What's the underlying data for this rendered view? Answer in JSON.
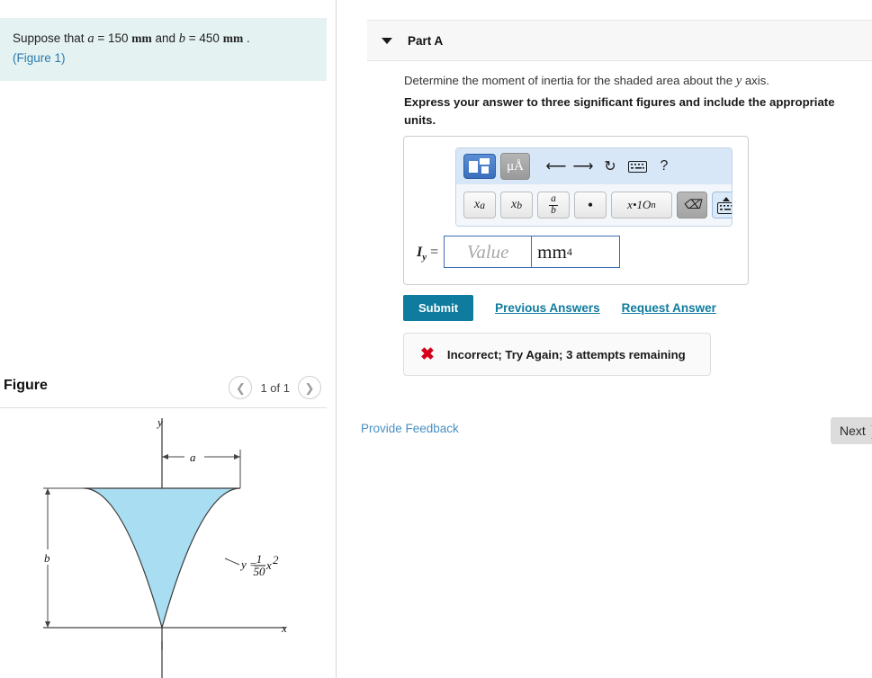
{
  "question": {
    "prefix": "Suppose that ",
    "var_a": "a",
    "eq1": " = 150 ",
    "unit1": "mm",
    "mid": " and ",
    "var_b": "b",
    "eq2": " = 450 ",
    "unit2": "mm",
    "suffix": " .",
    "figure_link": "(Figure 1)"
  },
  "figure_panel": {
    "title": "Figure",
    "counter": "1 of 1",
    "prev_icon": "chevron-left-icon",
    "next_icon": "chevron-right-icon"
  },
  "figure": {
    "y_axis_label": "y",
    "x_axis_label": "x",
    "dim_a_label": "a",
    "dim_b_label": "b",
    "curve_eq_lhs": "y =",
    "curve_eq_num": "1",
    "curve_eq_den": "50",
    "curve_eq_var": "x",
    "curve_eq_exp": "2",
    "fill_color": "#a9ddf2",
    "stroke_color": "#3a3a3a"
  },
  "part": {
    "caret_icon": "caret-down-icon",
    "title": "Part A",
    "prompt_pre": "Determine the moment of inertia for the shaded area about the ",
    "prompt_var": "y",
    "prompt_post": " axis.",
    "instruction": "Express your answer to three significant figures and include the appropriate units."
  },
  "toolbar": {
    "row1": [
      {
        "name": "template-picker-icon",
        "label": ""
      },
      {
        "name": "units-micro-angstrom-icon",
        "label": "μÅ"
      },
      {
        "name": "undo-icon",
        "label": "↶"
      },
      {
        "name": "redo-icon",
        "label": "↷"
      },
      {
        "name": "reset-icon",
        "label": "↻"
      },
      {
        "name": "keyboard-icon",
        "label": ""
      },
      {
        "name": "help-icon",
        "label": "?"
      }
    ],
    "row2": [
      {
        "name": "superscript-key",
        "label": "x",
        "sup": "a"
      },
      {
        "name": "subscript-key",
        "label": "x",
        "sub": "b"
      },
      {
        "name": "fraction-key",
        "num": "a",
        "den": "b"
      },
      {
        "name": "multiply-dot-key",
        "label": "•"
      },
      {
        "name": "scientific-notation-key",
        "label": "x•1O",
        "sup": "n"
      },
      {
        "name": "backspace-key",
        "label": ""
      },
      {
        "name": "toggle-keyboard-key",
        "label": ""
      }
    ]
  },
  "answer": {
    "label_main": "I",
    "label_sub": "y",
    "label_eq": "=",
    "value_placeholder": "Value",
    "unit_base": "mm",
    "unit_exponent": "4"
  },
  "actions": {
    "submit_label": "Submit",
    "previous_answers_label": "Previous Answers",
    "request_answer_label": "Request Answer",
    "provide_feedback_label": "Provide Feedback",
    "next_label": "Next",
    "next_chevron": "❯"
  },
  "feedback": {
    "icon": "cross-mark-icon",
    "icon_glyph": "✖",
    "message": "Incorrect; Try Again; 3 attempts remaining",
    "color": "#d6001c"
  },
  "colors": {
    "accent": "#0f7b9e",
    "question_bg": "#e4f2f1",
    "header_bg": "#f7f7f7",
    "link": "#4a90c4"
  }
}
